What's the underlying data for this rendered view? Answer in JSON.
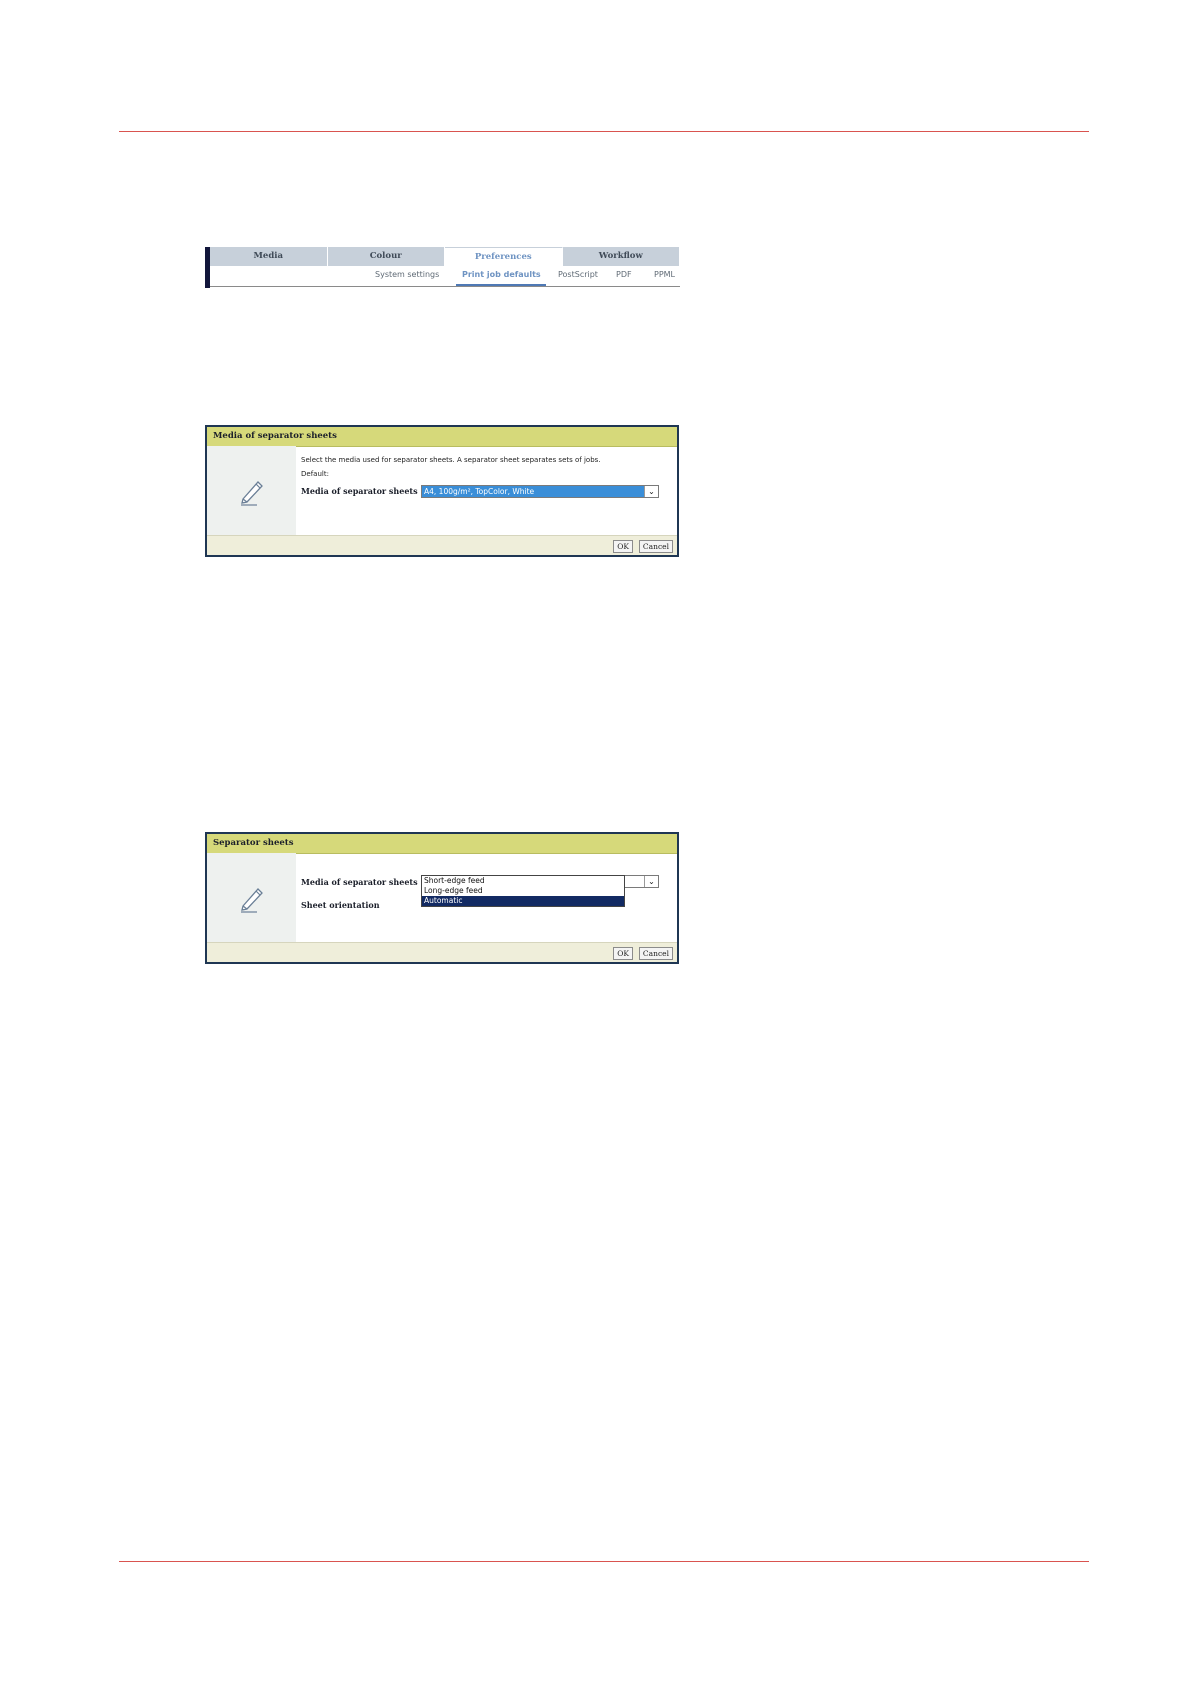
{
  "tabs": {
    "items": [
      "Media",
      "Colour",
      "Preferences",
      "Workflow"
    ],
    "active": "Preferences",
    "subitems": [
      "System settings",
      "Print job defaults",
      "PostScript",
      "PDF",
      "PPML"
    ],
    "active_sub": "Print job defaults"
  },
  "dialog1": {
    "title": "Media of separator sheets",
    "description": "Select the media used for separator sheets. A separator sheet separates sets of jobs.",
    "default_label": "Default:",
    "field_label": "Media of separator sheets",
    "field_value": "A4, 100g/m², TopColor, White",
    "ok": "OK",
    "cancel": "Cancel"
  },
  "dialog2": {
    "title": "Separator sheets",
    "field_label": "Media of separator sheets",
    "orientation_label": "Sheet orientation",
    "options": [
      "Short-edge feed",
      "Long-edge feed",
      "Automatic"
    ],
    "selected_option": "Automatic",
    "ok": "OK",
    "cancel": "Cancel"
  },
  "icons": {
    "dialog_icon": "pencil-icon",
    "dropdown_icon": "chevron-down-icon"
  },
  "colors": {
    "rule": "#d9534f",
    "title_bar": "#d6d97a",
    "selection": "#3a8ed8",
    "highlight": "#122a63"
  }
}
